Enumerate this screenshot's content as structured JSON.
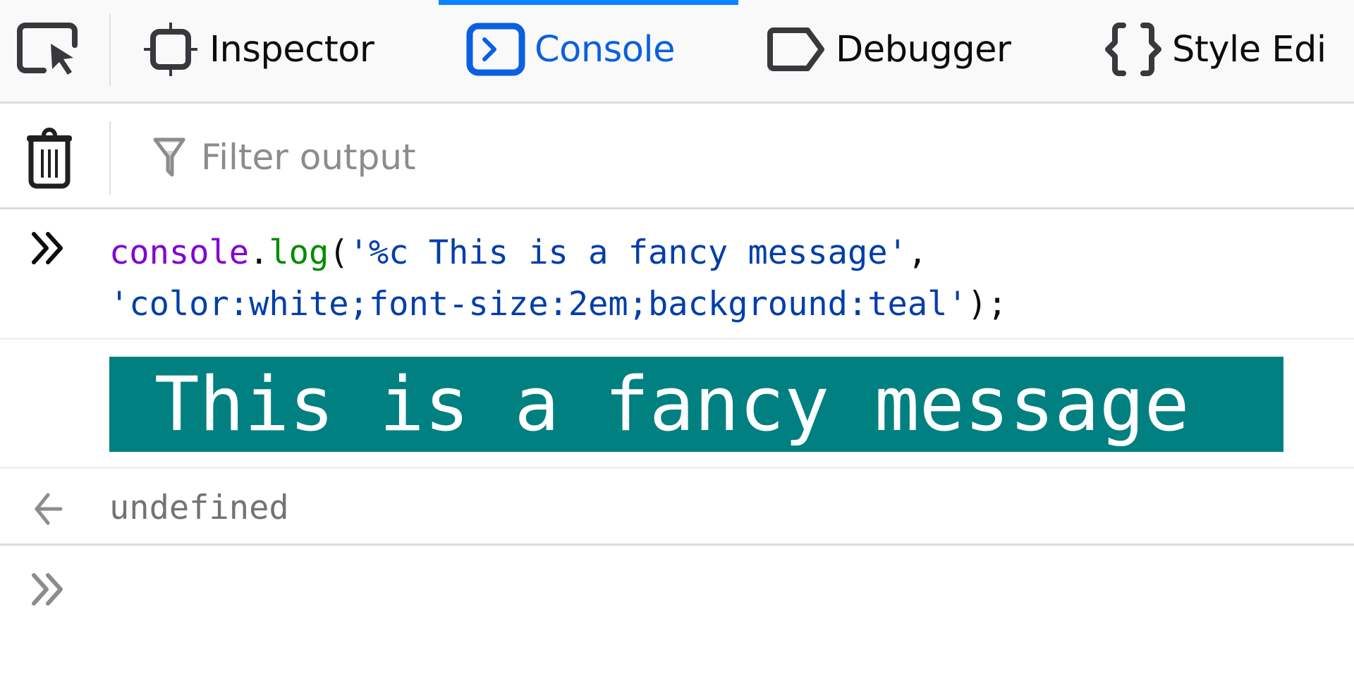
{
  "toolbar": {
    "picker_icon": "element-picker-icon",
    "tabs": [
      {
        "label": "Inspector",
        "icon": "inspector-icon",
        "active": false
      },
      {
        "label": "Console",
        "icon": "console-icon",
        "active": true
      },
      {
        "label": "Debugger",
        "icon": "debugger-icon",
        "active": false
      },
      {
        "label": "Style Edi",
        "icon": "style-editor-icon",
        "active": false
      }
    ],
    "accent_color": "#0a84ff"
  },
  "filterbar": {
    "clear_icon": "trash-icon",
    "filter_icon": "filter-funnel-icon",
    "filter_value": "",
    "filter_placeholder": "Filter output"
  },
  "console": {
    "input_entry": {
      "icon": "double-chevron-right-icon",
      "tokens": {
        "object": "console",
        "dot": ".",
        "method": "log",
        "open_paren": "(",
        "arg1": "'%c This is a fancy message'",
        "comma": ",",
        "arg2": "'color:white;font-size:2em;background:teal'",
        "close": ");"
      }
    },
    "styled_output": {
      "text": " This is a fancy message",
      "background": "#008080",
      "color": "#ffffff"
    },
    "result_entry": {
      "icon": "arrow-left-icon",
      "value": "undefined"
    },
    "prompt": {
      "icon": "double-chevron-right-icon",
      "value": ""
    }
  }
}
